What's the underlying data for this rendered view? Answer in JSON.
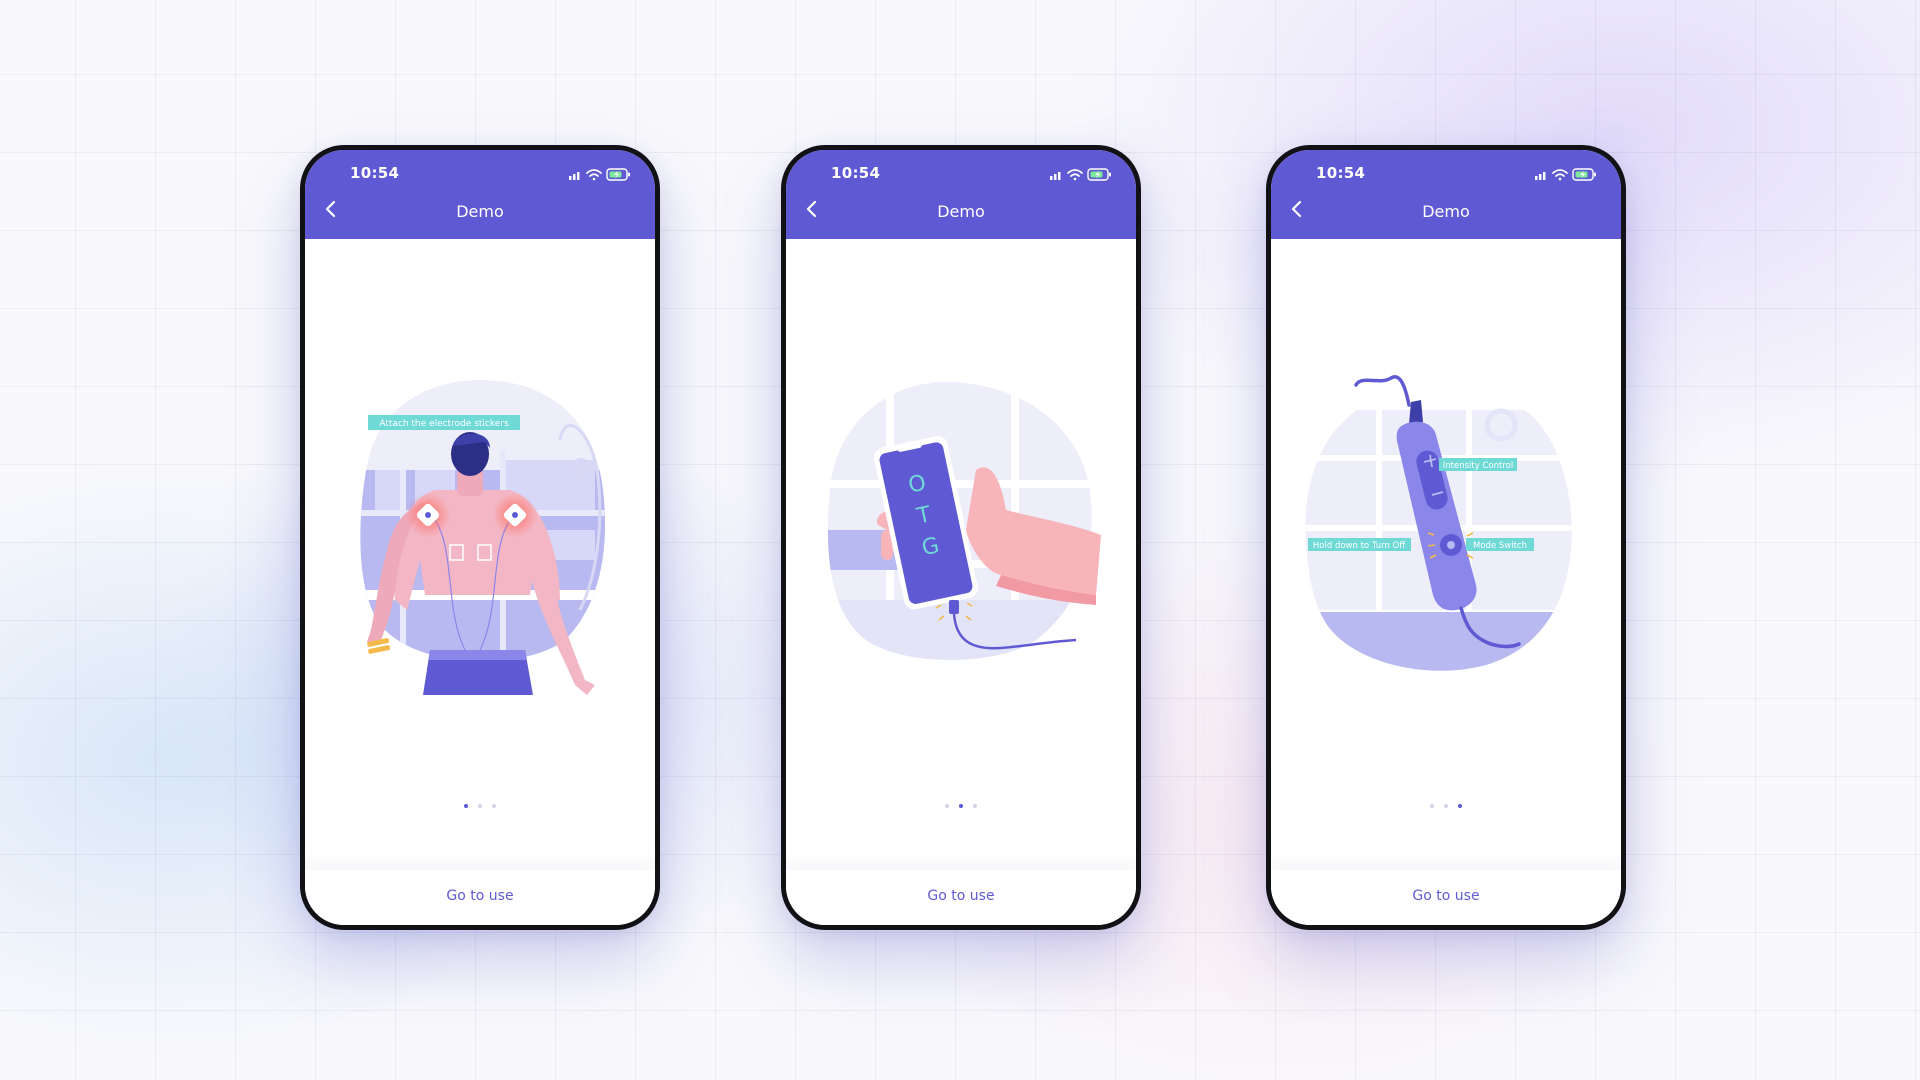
{
  "colors": {
    "accent": "#5f5ad3",
    "label_bg": "#6fd9d6",
    "skin": "#f3b6c4",
    "hair": "#2d2f86",
    "glow": "#ff6b5b",
    "pale": "#e4e4f8"
  },
  "phones": [
    {
      "status_time": "10:54",
      "title": "Demo",
      "illustration_labels": [
        "Attach the electrode stickers"
      ],
      "active_page": 1,
      "page_count": 3,
      "cta": "Go to use"
    },
    {
      "status_time": "10:54",
      "title": "Demo",
      "otg_letters": [
        "O",
        "T",
        "G"
      ],
      "active_page": 2,
      "page_count": 3,
      "cta": "Go to use"
    },
    {
      "status_time": "10:54",
      "title": "Demo",
      "illustration_labels": [
        "Intensity Control",
        "Hold down to Turn Off",
        "Mode Switch"
      ],
      "active_page": 3,
      "page_count": 3,
      "cta": "Go to use"
    }
  ],
  "icons": [
    "back-chevron-icon",
    "signal-icon",
    "wifi-icon",
    "battery-charging-icon"
  ]
}
